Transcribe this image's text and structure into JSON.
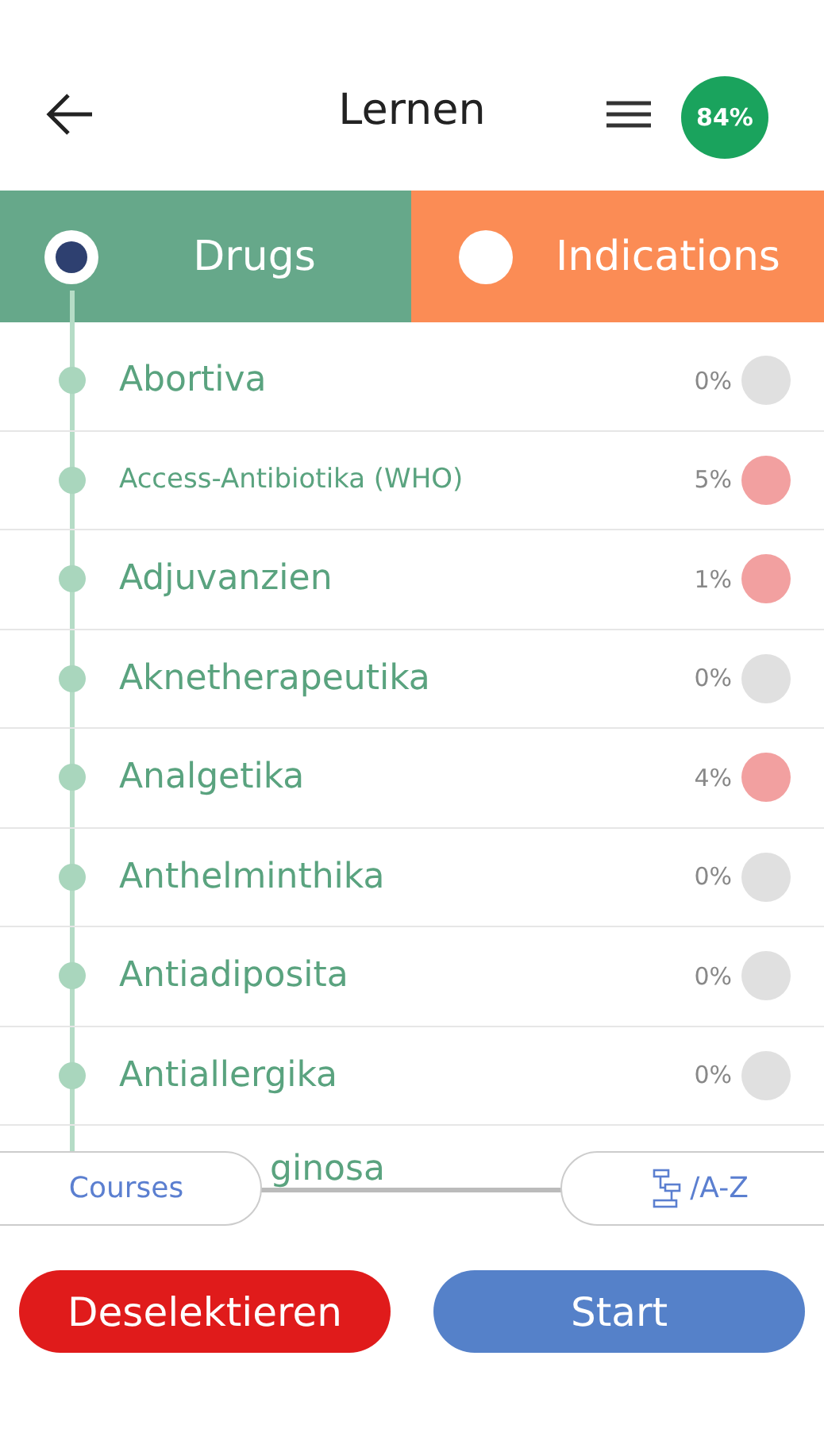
{
  "header": {
    "title": "Lernen",
    "score": "84%"
  },
  "tabs": [
    {
      "label": "Drugs",
      "selected": true,
      "color": "#66a88a"
    },
    {
      "label": "Indications",
      "selected": false,
      "color": "#fb8c55"
    }
  ],
  "items": [
    {
      "label": "Abortiva",
      "percent": "0%",
      "color": "#e0e0e0"
    },
    {
      "label": "Access-Antibiotika (WHO)",
      "percent": "5%",
      "color": "#f2a0a0"
    },
    {
      "label": "Adjuvanzien",
      "percent": "1%",
      "color": "#f2a0a0"
    },
    {
      "label": "Aknetherapeutika",
      "percent": "0%",
      "color": "#e0e0e0"
    },
    {
      "label": "Analgetika",
      "percent": "4%",
      "color": "#f2a0a0"
    },
    {
      "label": "Anthelminthika",
      "percent": "0%",
      "color": "#e0e0e0"
    },
    {
      "label": "Antiadiposita",
      "percent": "0%",
      "color": "#e0e0e0"
    },
    {
      "label": "Antiallergika",
      "percent": "0%",
      "color": "#e0e0e0"
    }
  ],
  "partial_item": "ginosa",
  "view_buttons": {
    "left": "Courses",
    "right": "/A-Z"
  },
  "actions": {
    "deselect": "Deselektieren",
    "start": "Start"
  }
}
